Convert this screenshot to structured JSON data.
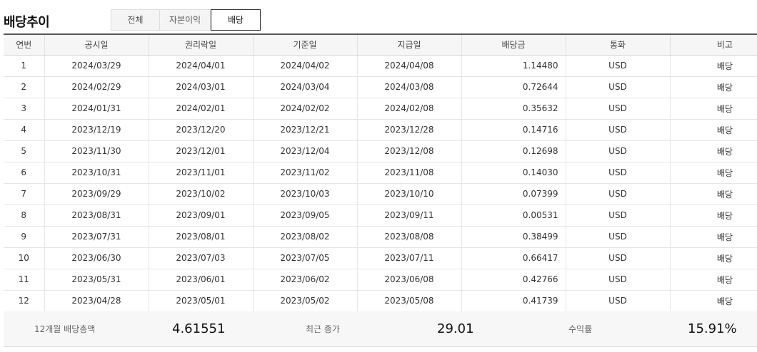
{
  "header": {
    "title": "배당추이"
  },
  "tabs": [
    {
      "label": "전체",
      "active": false
    },
    {
      "label": "자본이익",
      "active": false
    },
    {
      "label": "배당",
      "active": true
    }
  ],
  "table": {
    "columns": [
      "연번",
      "공시일",
      "권리락일",
      "기준일",
      "지급일",
      "배당금",
      "통화",
      "비고"
    ],
    "rows": [
      [
        "1",
        "2024/03/29",
        "2024/04/01",
        "2024/04/02",
        "2024/04/08",
        "1.14480",
        "USD",
        "배당"
      ],
      [
        "2",
        "2024/02/29",
        "2024/03/01",
        "2024/03/04",
        "2024/03/08",
        "0.72644",
        "USD",
        "배당"
      ],
      [
        "3",
        "2024/01/31",
        "2024/02/01",
        "2024/02/02",
        "2024/02/08",
        "0.35632",
        "USD",
        "배당"
      ],
      [
        "4",
        "2023/12/19",
        "2023/12/20",
        "2023/12/21",
        "2023/12/28",
        "0.14716",
        "USD",
        "배당"
      ],
      [
        "5",
        "2023/11/30",
        "2023/12/01",
        "2023/12/04",
        "2023/12/08",
        "0.12698",
        "USD",
        "배당"
      ],
      [
        "6",
        "2023/10/31",
        "2023/11/01",
        "2023/11/02",
        "2023/11/08",
        "0.14030",
        "USD",
        "배당"
      ],
      [
        "7",
        "2023/09/29",
        "2023/10/02",
        "2023/10/03",
        "2023/10/10",
        "0.07399",
        "USD",
        "배당"
      ],
      [
        "8",
        "2023/08/31",
        "2023/09/01",
        "2023/09/05",
        "2023/09/11",
        "0.00531",
        "USD",
        "배당"
      ],
      [
        "9",
        "2023/07/31",
        "2023/08/01",
        "2023/08/02",
        "2023/08/08",
        "0.38499",
        "USD",
        "배당"
      ],
      [
        "10",
        "2023/06/30",
        "2023/07/03",
        "2023/07/05",
        "2023/07/11",
        "0.66417",
        "USD",
        "배당"
      ],
      [
        "11",
        "2023/05/31",
        "2023/06/01",
        "2023/06/02",
        "2023/06/08",
        "0.42766",
        "USD",
        "배당"
      ],
      [
        "12",
        "2023/04/28",
        "2023/05/01",
        "2023/05/02",
        "2023/05/08",
        "0.41739",
        "USD",
        "배당"
      ]
    ]
  },
  "summary": {
    "annual_label": "12개월 배당총액",
    "annual_value": "4.61551",
    "close_label": "최근 종가",
    "close_value": "29.01",
    "yield_label": "수익률",
    "yield_value": "15.91%"
  }
}
